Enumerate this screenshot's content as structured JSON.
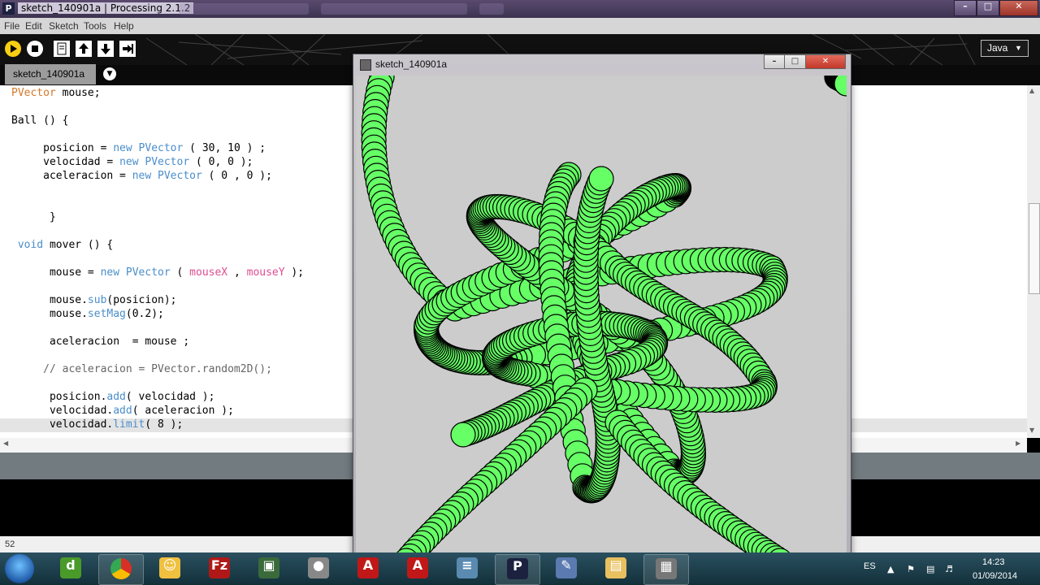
{
  "window": {
    "title": "sketch_140901a | Processing 2.1.2",
    "app_icon": "P"
  },
  "menu": [
    "File",
    "Edit",
    "Sketch",
    "Tools",
    "Help"
  ],
  "toolbar": {
    "mode_label": "Java"
  },
  "tab": {
    "label": "sketch_140901a"
  },
  "code_lines": [
    [
      [
        "PVector",
        "org"
      ],
      [
        " mouse;",
        ""
      ]
    ],
    [],
    [
      [
        "Ball () {",
        ""
      ]
    ],
    [],
    [
      [
        "     posicion = ",
        ""
      ],
      [
        "new",
        "blue"
      ],
      [
        " ",
        ""
      ],
      [
        "PVector",
        "pvec"
      ],
      [
        " ( 30, 10 ) ;",
        ""
      ]
    ],
    [
      [
        "     velocidad = ",
        ""
      ],
      [
        "new",
        "blue"
      ],
      [
        " ",
        ""
      ],
      [
        "PVector",
        "pvec"
      ],
      [
        " ( 0, 0 );",
        ""
      ]
    ],
    [
      [
        "     aceleracion = ",
        ""
      ],
      [
        "new",
        "blue"
      ],
      [
        " ",
        ""
      ],
      [
        "PVector",
        "pvec"
      ],
      [
        " ( 0 , 0 );",
        ""
      ]
    ],
    [],
    [],
    [
      [
        "      }",
        ""
      ]
    ],
    [],
    [
      [
        " ",
        ""
      ],
      [
        "void",
        "blue"
      ],
      [
        " mover () {",
        ""
      ]
    ],
    [],
    [
      [
        "      mouse = ",
        ""
      ],
      [
        "new",
        "blue"
      ],
      [
        " ",
        ""
      ],
      [
        "PVector",
        "pvec"
      ],
      [
        " ( ",
        ""
      ],
      [
        "mouseX",
        "pink"
      ],
      [
        " , ",
        ""
      ],
      [
        "mouseY",
        "pink"
      ],
      [
        " );",
        ""
      ]
    ],
    [],
    [
      [
        "      mouse.",
        ""
      ],
      [
        "sub",
        "blue"
      ],
      [
        "(posicion);",
        ""
      ]
    ],
    [
      [
        "      mouse.",
        ""
      ],
      [
        "setMag",
        "blue"
      ],
      [
        "(0.2);",
        ""
      ]
    ],
    [],
    [
      [
        "      aceleracion  = mouse ;",
        ""
      ]
    ],
    [],
    [
      [
        "     // aceleracion = PVector.random2D();",
        "cmt"
      ]
    ],
    [],
    [
      [
        "      posicion.",
        ""
      ],
      [
        "add",
        "blue"
      ],
      [
        "( velocidad );",
        ""
      ]
    ],
    [
      [
        "      velocidad.",
        ""
      ],
      [
        "add",
        "blue"
      ],
      [
        "( aceleracion );",
        ""
      ]
    ],
    [
      [
        "      velocidad.",
        ""
      ],
      [
        "limit",
        "blue"
      ],
      [
        "( 8 );",
        ""
      ]
    ]
  ],
  "status": {
    "line_number": "52"
  },
  "sketch_window": {
    "title": "sketch_140901a"
  },
  "canvas": {
    "background": "#cccccc",
    "ball_fill": "#66ff66",
    "ball_stroke": "#000000"
  },
  "taskbar": {
    "apps": [
      "dreamweaver-icon",
      "chrome-icon",
      "file-manager-icon",
      "filezilla-icon",
      "terminal-icon",
      "sound-app-icon",
      "autocad-icon",
      "autocad-icon",
      "calculator-icon",
      "processing-icon",
      "paint-icon",
      "folder-icon",
      "sketch-icon"
    ],
    "lang": "ES",
    "time": "14:23",
    "date": "01/09/2014"
  }
}
